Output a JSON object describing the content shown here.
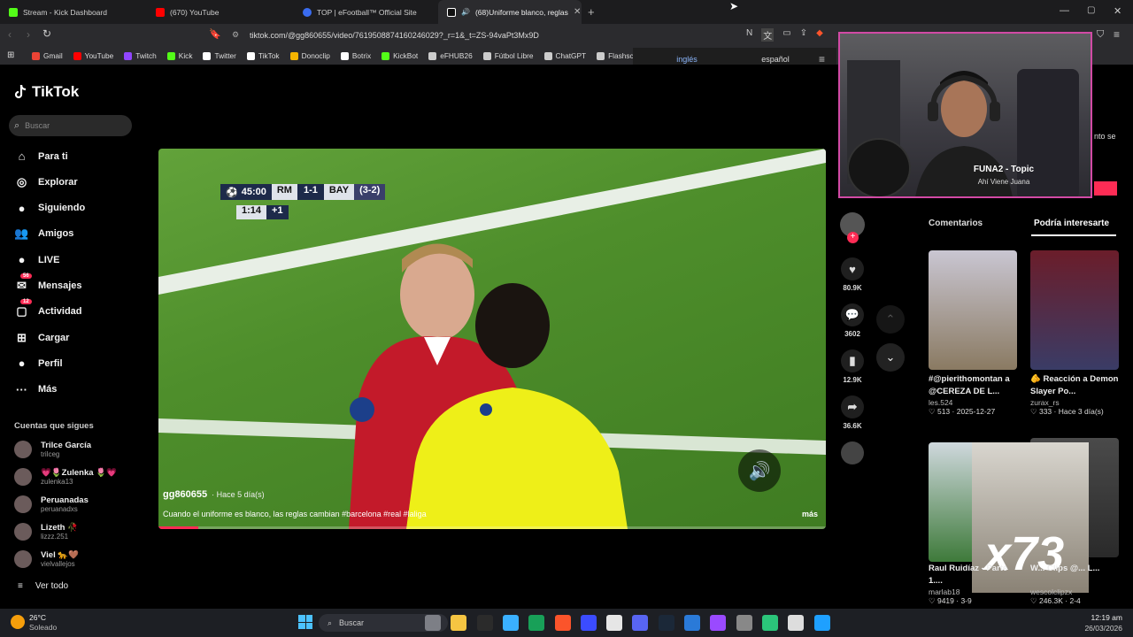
{
  "tabs": [
    {
      "title": "Stream - Kick Dashboard",
      "color": "#53fc18"
    },
    {
      "title": "(670) YouTube",
      "color": "#ff0000"
    },
    {
      "title": "TOP | eFootball™ Official Site",
      "color": "#3a6cf0"
    },
    {
      "title": "(68)Uniforme blanco, reglas d",
      "color": "#ffffff"
    }
  ],
  "address": {
    "url": "tiktok.com/@gg860655/video/7619508874160246029?_r=1&_t=ZS-94vaPt3Mx9D"
  },
  "bookmarks": [
    {
      "label": "Gmail",
      "color": "#ea4335"
    },
    {
      "label": "YouTube",
      "color": "#ff0000"
    },
    {
      "label": "Twitch",
      "color": "#9146ff"
    },
    {
      "label": "Kick",
      "color": "#53fc18"
    },
    {
      "label": "Twitter",
      "color": "#ffffff"
    },
    {
      "label": "TikTok",
      "color": "#ffffff"
    },
    {
      "label": "Donoclip",
      "color": "#f5b400"
    },
    {
      "label": "Botrix",
      "color": "#ffffff"
    },
    {
      "label": "KickBot",
      "color": "#53fc18"
    },
    {
      "label": "eFHUB26",
      "color": "#cccccc"
    },
    {
      "label": "Fútbol Libre",
      "color": "#cccccc"
    },
    {
      "label": "ChatGPT",
      "color": "#cccccc"
    },
    {
      "label": "Flashscore",
      "color": "#cccccc"
    }
  ],
  "translate": {
    "lang1": "inglés",
    "lang2": "español"
  },
  "tiktok": {
    "logo": "TikTok",
    "search_placeholder": "Buscar",
    "nav": [
      {
        "label": "Para ti",
        "icon": "home-icon",
        "glyph": "⌂"
      },
      {
        "label": "Explorar",
        "icon": "compass-icon",
        "glyph": "◎"
      },
      {
        "label": "Siguiendo",
        "icon": "following-avatar-icon",
        "glyph": "●"
      },
      {
        "label": "Amigos",
        "icon": "friends-icon",
        "glyph": "👥"
      },
      {
        "label": "LIVE",
        "icon": "live-avatar-icon",
        "glyph": "●"
      },
      {
        "label": "Mensajes",
        "icon": "messages-icon",
        "glyph": "✉",
        "badge": "56"
      },
      {
        "label": "Actividad",
        "icon": "activity-icon",
        "glyph": "▢",
        "badge": "12"
      },
      {
        "label": "Cargar",
        "icon": "upload-icon",
        "glyph": "⊞"
      },
      {
        "label": "Perfil",
        "icon": "profile-avatar-icon",
        "glyph": "●"
      },
      {
        "label": "Más",
        "icon": "more-icon",
        "glyph": "···"
      }
    ],
    "following_title": "Cuentas que sigues",
    "following": [
      {
        "name": "Trilce García",
        "user": "trilceg"
      },
      {
        "name": "💗🌷Zulenka 🌷💗",
        "user": "zulenka13"
      },
      {
        "name": "Peruanadas",
        "user": "peruanadxs"
      },
      {
        "name": "Lizeth 🥀",
        "user": "lizzz.251"
      },
      {
        "name": "Viel 🐆🤎",
        "user": "vielvallejos"
      }
    ],
    "see_all": "Ver todo"
  },
  "video": {
    "scoreboard": {
      "time": "45:00",
      "home": "RM",
      "score": "1-1",
      "away": "BAY",
      "agg": "(3-2)",
      "extra_time": "1:14",
      "added": "+1"
    },
    "author": "gg860655",
    "posted": "· Hace 5 día(s)",
    "caption": "Cuando el uniforme es blanco, las reglas cambian #barcelona #real #laliga",
    "more": "más",
    "progress": 0.06
  },
  "actions": {
    "likes": "80.9K",
    "comments": "3602",
    "saves": "12.9K",
    "shares": "36.6K"
  },
  "webcam": {
    "song_title": "FUNA2 - Topic",
    "song_sub": "Ahí Viene Juana",
    "peek_text": "nto se"
  },
  "right_panel": {
    "tab_comments": "Comentarios",
    "tab_related": "Podría interesarte",
    "cards": [
      {
        "title": "#@pierithomontan a @CEREZA DE L...",
        "user": "les.524",
        "stats": "♡ 513 · 2025-12-27"
      },
      {
        "title": "🫵 Reacción a Demon Slayer Po...",
        "user": "zurax_rs",
        "stats": "♡ 333 · Hace 3 día(s)"
      },
      {
        "title": "Raul Ruidíaz - Parte 1....",
        "user": "marlab18",
        "stats": "♡ 9419 · 3-9"
      },
      {
        "title": "W... Clips @... L...",
        "user": "wescolclipzx",
        "stats": "♡ 246.3K · 2-4"
      }
    ],
    "overlay_counter": "x73"
  },
  "taskbar": {
    "temp": "26°C",
    "weather": "Soleado",
    "search": "Buscar",
    "time": "12:19 am",
    "date": "26/03/2026"
  }
}
